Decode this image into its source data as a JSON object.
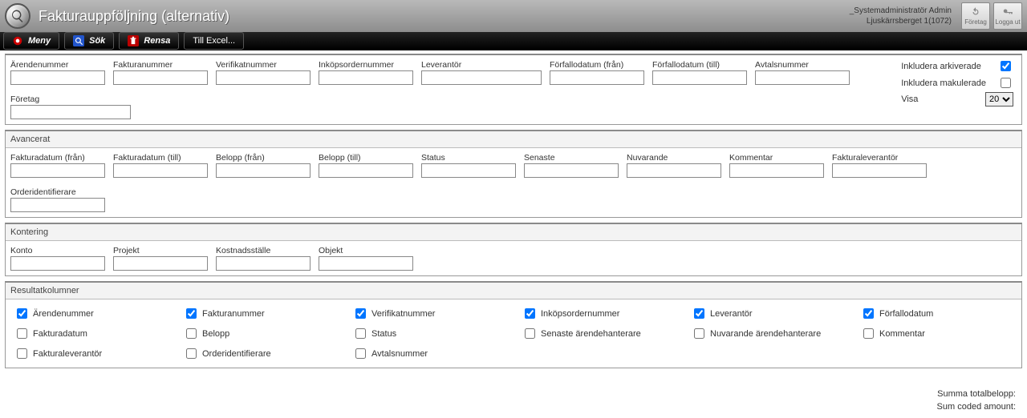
{
  "header": {
    "title": "Fakturauppföljning (alternativ)",
    "user_line1": "_Systemadministratör Admin",
    "user_line2": "Ljuskärrsberget 1(1072)",
    "btn_company": "Företag",
    "btn_logout": "Logga ut"
  },
  "menubar": {
    "menu": "Meny",
    "search": "Sök",
    "clear": "Rensa",
    "excel": "Till Excel..."
  },
  "filters": {
    "arendenummer": "Ärendenummer",
    "fakturanummer": "Fakturanummer",
    "verifikatnummer": "Verifikatnummer",
    "inkopsordernummer": "Inköpsordernummer",
    "leverantor": "Leverantör",
    "forfallodatum_fran": "Förfallodatum (från)",
    "forfallodatum_till": "Förfallodatum (till)",
    "avtalsnummer": "Avtalsnummer",
    "foretag": "Företag",
    "inkludera_arkiverade": "Inkludera arkiverade",
    "inkludera_makulerade": "Inkludera makulerade",
    "visa": "Visa",
    "visa_value": "20"
  },
  "advanced": {
    "title": "Avancerat",
    "fakturadatum_fran": "Fakturadatum (från)",
    "fakturadatum_till": "Fakturadatum (till)",
    "belopp_fran": "Belopp (från)",
    "belopp_till": "Belopp (till)",
    "status": "Status",
    "senaste": "Senaste",
    "nuvarande": "Nuvarande",
    "kommentar": "Kommentar",
    "fakturaleverantor": "Fakturaleverantör",
    "orderidentifierare": "Orderidentifierare"
  },
  "kontering": {
    "title": "Kontering",
    "konto": "Konto",
    "projekt": "Projekt",
    "kostnadsstalle": "Kostnadsställe",
    "objekt": "Objekt"
  },
  "resultcols": {
    "title": "Resultatkolumner",
    "items": [
      {
        "label": "Ärendenummer",
        "checked": true
      },
      {
        "label": "Fakturanummer",
        "checked": true
      },
      {
        "label": "Verifikatnummer",
        "checked": true
      },
      {
        "label": "Inköpsordernummer",
        "checked": true
      },
      {
        "label": "Leverantör",
        "checked": true
      },
      {
        "label": "Förfallodatum",
        "checked": true
      },
      {
        "label": "Fakturadatum",
        "checked": false
      },
      {
        "label": "Belopp",
        "checked": false
      },
      {
        "label": "Status",
        "checked": false
      },
      {
        "label": "Senaste ärendehanterare",
        "checked": false
      },
      {
        "label": "Nuvarande ärendehanterare",
        "checked": false
      },
      {
        "label": "Kommentar",
        "checked": false
      },
      {
        "label": "Fakturaleverantör",
        "checked": false
      },
      {
        "label": "Orderidentifierare",
        "checked": false
      },
      {
        "label": "Avtalsnummer",
        "checked": false
      }
    ]
  },
  "footer": {
    "sum_total": "Summa totalbelopp:",
    "sum_coded": "Sum coded amount:"
  }
}
